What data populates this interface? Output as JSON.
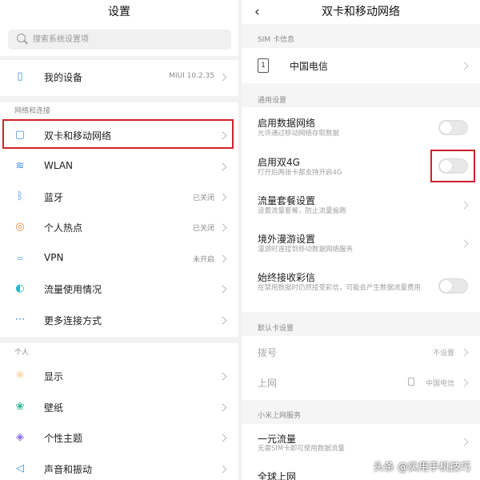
{
  "left": {
    "title": "设置",
    "search_placeholder": "搜索系统设置项",
    "my_device": {
      "label": "我的设备",
      "value": "MIUI 10.2.35"
    },
    "section_network": "网络和连接",
    "network_items": [
      {
        "label": "双卡和移动网络",
        "value": "",
        "icon": "dual-sim-icon"
      },
      {
        "label": "WLAN",
        "value": "",
        "icon": "wifi-icon"
      },
      {
        "label": "蓝牙",
        "value": "已关闭",
        "icon": "bluetooth-icon"
      },
      {
        "label": "个人热点",
        "value": "已关闭",
        "icon": "hotspot-icon"
      },
      {
        "label": "VPN",
        "value": "未开启",
        "icon": "vpn-icon"
      },
      {
        "label": "流量使用情况",
        "value": "",
        "icon": "data-usage-icon"
      },
      {
        "label": "更多连接方式",
        "value": "",
        "icon": "more-connections-icon"
      }
    ],
    "section_personal": "个人",
    "personal_items": [
      {
        "label": "显示",
        "icon": "display-icon"
      },
      {
        "label": "壁纸",
        "icon": "wallpaper-icon"
      },
      {
        "label": "个性主题",
        "icon": "theme-icon"
      },
      {
        "label": "声音和振动",
        "icon": "sound-icon"
      }
    ]
  },
  "right": {
    "title": "双卡和移动网络",
    "section_sim": "SIM 卡信息",
    "sim1": {
      "slot": "1",
      "carrier": "中国电信"
    },
    "section_general": "通用设置",
    "enable_data": {
      "label": "启用数据网络",
      "sub": "允许通过移动网络存取数据",
      "on": false
    },
    "dual_4g": {
      "label": "启用双4G",
      "sub": "打开后两张卡都支持开启4G",
      "on": false
    },
    "data_plan": {
      "label": "流量套餐设置",
      "sub": "设置流量套餐，防止流量偷跑"
    },
    "roaming": {
      "label": "境外漫游设置",
      "sub": "漫游时连接到移动数据网络服务"
    },
    "mms": {
      "label": "始终接收彩信",
      "sub": "在禁用数据时仍然接受彩信，可能会产生数据流量费用",
      "on": false
    },
    "section_default": "默认卡设置",
    "dial": {
      "label": "拨号",
      "value": "不设置"
    },
    "internet": {
      "label": "上网",
      "value": "中国电信"
    },
    "section_mi": "小米上网服务",
    "one_yuan": {
      "label": "一元流量",
      "sub": "无需SIM卡即可使用数据流量"
    },
    "global": {
      "label": "全球上网"
    }
  },
  "watermark": "头条 @实用手机技巧",
  "colors": {
    "highlight": "#d02128",
    "separator": "#f2f2f2"
  }
}
